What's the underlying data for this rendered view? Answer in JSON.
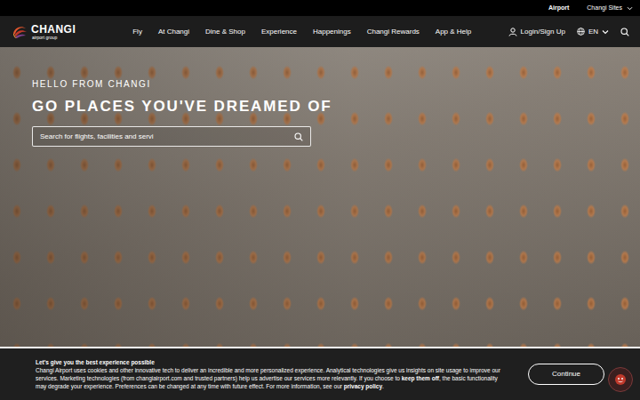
{
  "top_bar": {
    "links": [
      {
        "label": "Airport",
        "selected": true,
        "kind": "link"
      },
      {
        "label": "Changi Sites",
        "selected": false,
        "kind": "menu"
      }
    ]
  },
  "header": {
    "logo": {
      "name": "CHANGI",
      "tagline": "airport group"
    },
    "nav": [
      "Fly",
      "At Changi",
      "Dine & Shop",
      "Experience",
      "Happenings",
      "Changi Rewards",
      "App & Help"
    ],
    "login": "Login/Sign Up",
    "language": "EN"
  },
  "hero": {
    "greeting": "HELLO FROM CHANGI",
    "headline": "GO PLACES YOU'VE DREAMED OF",
    "search": {
      "placeholder": "Search for flights, facilities and servi"
    }
  },
  "cookie_banner": {
    "title": "Let's give you the best experience possible",
    "body": [
      {
        "text": "Changi Airport uses cookies and other innovative tech to deliver an incredible and more personalized experience. Analytical technologies give us insights on site usage to improve our services. Marketing technologies (from changiairport.com and trusted partners) help us advertise our services more relevantly. If you choose to ",
        "bold": false
      },
      {
        "text": "keep them off",
        "bold": true
      },
      {
        "text": ", the basic functionality may degrade your experience. Preferences can be changed at any time with future effect. For more information, see our ",
        "bold": false
      },
      {
        "text": "privacy policy",
        "bold": true
      },
      {
        "text": ".",
        "bold": false
      }
    ],
    "button": "Continue"
  }
}
